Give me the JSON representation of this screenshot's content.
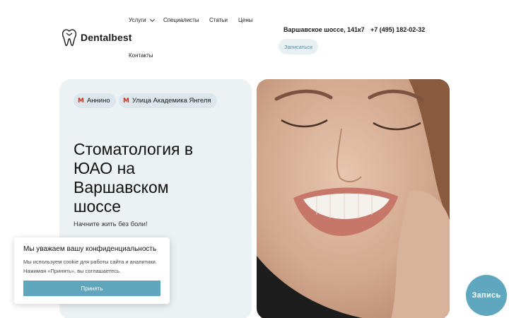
{
  "brand": {
    "name": "Dentalbest"
  },
  "nav": {
    "services": "Услуги",
    "specialists": "Специалисты",
    "articles": "Статьи",
    "prices": "Цены",
    "contacts": "Контакты"
  },
  "header": {
    "address": "Варшавское шоссе, 141к7",
    "phone": "+7 (495) 182-02-32",
    "signup_label": "Записаться"
  },
  "hero": {
    "metro_stations": [
      "Аннино",
      "Улица Академика Янгеля"
    ],
    "metro_icon": "М",
    "title": "Стоматология в ЮАО на Варшавском шоссе",
    "subtitle": "Начните жить без боли!"
  },
  "cookie": {
    "title": "Мы уважаем вашу конфиденциальность",
    "text": "Мы используем cookie для работы сайта и аналитики. Нажимая «Принять», вы соглашаетесь.",
    "accept_label": "Принять"
  },
  "fab": {
    "label": "Запись"
  },
  "colors": {
    "accent": "#5ea7be",
    "metro_red": "#d9251c",
    "hero_bg": "#ecf1f4"
  },
  "icons": {
    "logo": "tooth-icon",
    "dropdown": "chevron-down-icon",
    "metro": "metro-icon"
  }
}
